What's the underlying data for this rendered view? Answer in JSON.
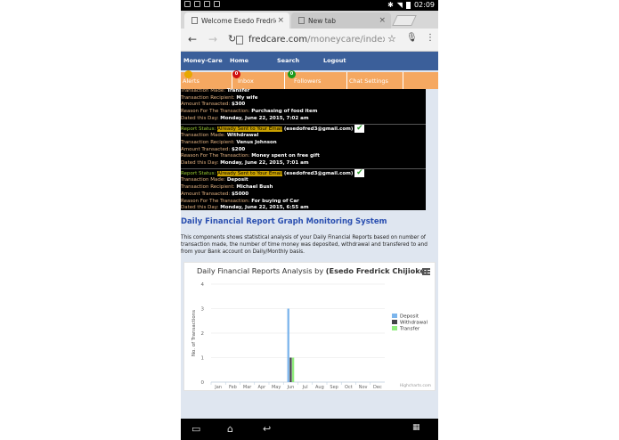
{
  "status_bar": {
    "time": "02:09"
  },
  "browser": {
    "tabs": [
      {
        "title": "Welcome Esedo Fredrick Chi",
        "close": "×"
      },
      {
        "title": "New tab",
        "close": "×"
      }
    ],
    "url_host": "fredcare.com",
    "url_path": "/moneycare/index_ana",
    "icons": {
      "back": "arrow-left",
      "forward": "arrow-right",
      "reload": "reload",
      "star": "star",
      "mic": "mic",
      "menu": "kebab"
    }
  },
  "site_nav": {
    "items": [
      "Money-Care",
      "Home",
      "Search",
      "Logout"
    ]
  },
  "sub_nav": {
    "items": [
      {
        "label": "Alerts",
        "badge": ""
      },
      {
        "label": "Inbox",
        "badge": "0"
      },
      {
        "label": "Followers",
        "badge": "0"
      },
      {
        "label": "Chat Settings",
        "badge": ""
      }
    ]
  },
  "reports": {
    "labels": {
      "made": "Transaction Made:",
      "recipient": "Transaction Recipient:",
      "amount": "Amount Transacted:",
      "reason": "Reason For The Transaction:",
      "dated": "Dated this Day:",
      "status": "Report Status:"
    },
    "status_text": "Already Sent to Your Email",
    "email": "(esedofred3@gmail.com)",
    "partial": {
      "made": "Transfer",
      "recipient": "My wife",
      "amount": "$300",
      "reason": "Purchasing of food item",
      "dated": "Monday, June 22, 2015, 7:02 am"
    },
    "entries": [
      {
        "made": "Withdrawal",
        "recipient": "Venus Johnson",
        "amount": "$200",
        "reason": "Money spent on free gift",
        "dated": "Monday, June 22, 2015, 7:01 am"
      },
      {
        "made": "Deposit",
        "recipient": "Michael Bush",
        "amount": "$5000",
        "reason": "For buying of Car",
        "dated": "Monday, June 22, 2015, 6:55 am"
      }
    ]
  },
  "content": {
    "heading": "Daily Financial Report Graph Monitoring System",
    "description": "This components shows statistical analysis of your Daily Financial Reports based on number of transaction made, the number of time money was deposited, withdrawal and transfered to and from your Bank account on Daily/Monthly basis."
  },
  "chart_title_prefix": "Daily Financial Reports Analysis by ",
  "chart_title_name": "(Esedo Fredrick Chijioke)",
  "chart_credits": "Highcharts.com",
  "chart_data": {
    "type": "bar",
    "title": "Daily Financial Reports Analysis by (Esedo Fredrick Chijioke)",
    "ylabel": "No. of Transactions",
    "xlabel": "",
    "categories": [
      "Jan",
      "Feb",
      "Mar",
      "Apr",
      "May",
      "Jun",
      "Jul",
      "Aug",
      "Sep",
      "Oct",
      "Nov",
      "Dec"
    ],
    "ylim": [
      0,
      4
    ],
    "yticks": [
      "0",
      "1",
      "2",
      "3",
      "4"
    ],
    "series": [
      {
        "name": "Deposit",
        "color": "#7cb5ec",
        "values": [
          0,
          0,
          0,
          0,
          0,
          3,
          0,
          0,
          0,
          0,
          0,
          0
        ]
      },
      {
        "name": "Withdrawal",
        "color": "#434348",
        "values": [
          0,
          0,
          0,
          0,
          0,
          1,
          0,
          0,
          0,
          0,
          0,
          0
        ]
      },
      {
        "name": "Transfer",
        "color": "#90ed7d",
        "values": [
          0,
          0,
          0,
          0,
          0,
          1,
          0,
          0,
          0,
          0,
          0,
          0
        ]
      }
    ],
    "legend": "right",
    "grid": true
  }
}
